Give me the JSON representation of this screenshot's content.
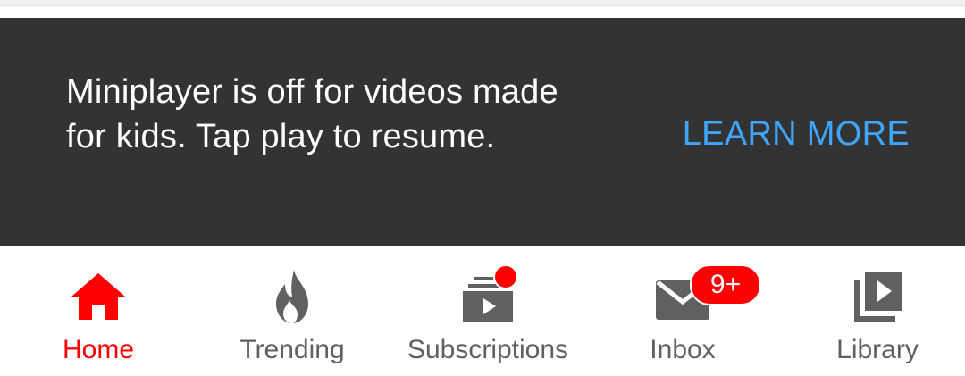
{
  "snackbar": {
    "message": "Miniplayer is off for videos made for kids. Tap play to resume.",
    "action_label": "LEARN MORE",
    "background": "#333333",
    "action_color": "#3ea6ff"
  },
  "bottom_nav": {
    "items": [
      {
        "label": "Home",
        "icon": "home-icon",
        "active": true
      },
      {
        "label": "Trending",
        "icon": "fire-icon",
        "active": false
      },
      {
        "label": "Subscriptions",
        "icon": "subscriptions-icon",
        "active": false,
        "has_dot": true
      },
      {
        "label": "Inbox",
        "icon": "mail-icon",
        "active": false,
        "badge": "9+"
      },
      {
        "label": "Library",
        "icon": "library-icon",
        "active": false
      }
    ],
    "active_color": "#ff0000",
    "inactive_color": "#606060"
  }
}
